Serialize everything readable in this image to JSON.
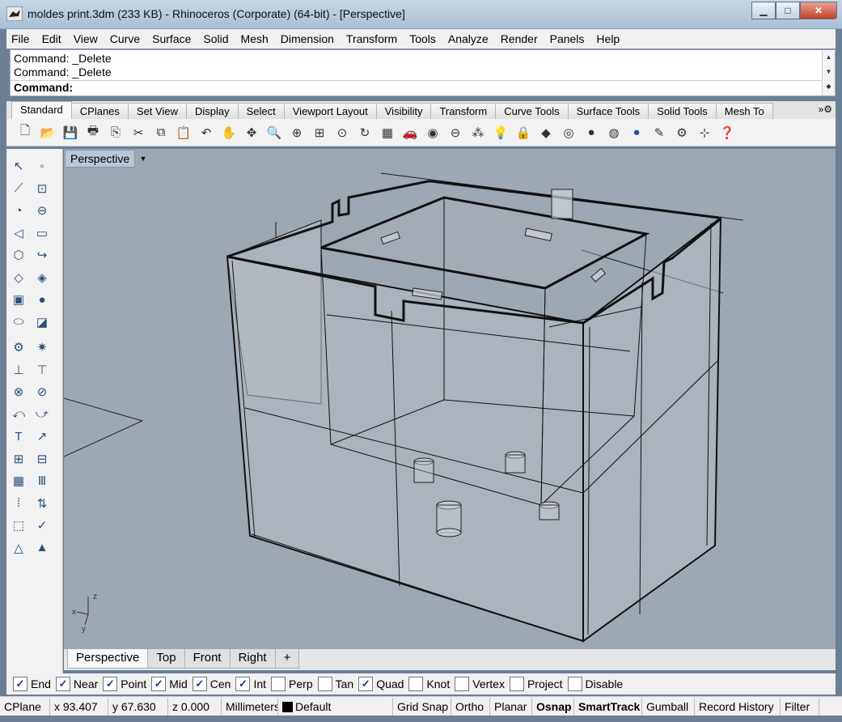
{
  "window": {
    "title": "moldes print.3dm (233 KB) - Rhinoceros (Corporate) (64-bit) - [Perspective]",
    "minimize": "▁",
    "maximize": "□",
    "close": "✕"
  },
  "menu": [
    "File",
    "Edit",
    "View",
    "Curve",
    "Surface",
    "Solid",
    "Mesh",
    "Dimension",
    "Transform",
    "Tools",
    "Analyze",
    "Render",
    "Panels",
    "Help"
  ],
  "command": {
    "history": [
      "Command: _Delete",
      "Command: _Delete"
    ],
    "prompt": "Command:"
  },
  "toolbar_tabs": [
    "Standard",
    "CPlanes",
    "Set View",
    "Display",
    "Select",
    "Viewport Layout",
    "Visibility",
    "Transform",
    "Curve Tools",
    "Surface Tools",
    "Solid Tools",
    "Mesh To"
  ],
  "active_toolbar_tab": "Standard",
  "toolbar_icons": [
    "new-icon",
    "open-icon",
    "save-icon",
    "print-icon",
    "import-icon",
    "cut-icon",
    "copy-icon",
    "paste-icon",
    "undo-icon",
    "pan-icon",
    "rotate-view-icon",
    "zoom-icon",
    "zoom-window-icon",
    "zoom-extents-icon",
    "zoom-selected-icon",
    "redraw-icon",
    "viewport-layout-icon",
    "car-icon",
    "camera-icon",
    "point-icon",
    "lock-icon",
    "light-icon",
    "layer-lock-icon",
    "render-icon",
    "color-wheel-icon",
    "material-sphere-icon",
    "display-sphere-icon",
    "render-sphere-icon",
    "pencil-icon",
    "settings-icon",
    "grid-icon",
    "help-icon"
  ],
  "left_tools": [
    "select-icon",
    "point-icon",
    "polyline-icon",
    "curve-icon",
    "circle-icon",
    "ellipse-icon",
    "arc-icon",
    "rectangle-icon",
    "polygon-icon",
    "fillet-icon",
    "surface-icon",
    "loft-icon",
    "box-icon",
    "sphere-icon",
    "cylinder-icon",
    "extrude-icon",
    "gear-icon",
    "explode-icon",
    "trim-icon",
    "split-icon",
    "boolean-icon",
    "boolean-split-icon",
    "offset-icon",
    "blend-icon",
    "text-icon",
    "dimension-icon",
    "array-icon",
    "transform-icon",
    "solid-box-icon",
    "bar-icon",
    "polygon-array-icon",
    "snap-icon",
    "cube-icon",
    "check-icon",
    "shapes-icon",
    "pyramid-icon"
  ],
  "viewport": {
    "label": "Perspective",
    "axis_x": "x",
    "axis_y": "y",
    "axis_z": "z"
  },
  "viewport_tabs": [
    "Perspective",
    "Top",
    "Front",
    "Right",
    "+"
  ],
  "active_viewport_tab": "Perspective",
  "osnaps": [
    {
      "label": "End",
      "checked": true
    },
    {
      "label": "Near",
      "checked": true
    },
    {
      "label": "Point",
      "checked": true
    },
    {
      "label": "Mid",
      "checked": true
    },
    {
      "label": "Cen",
      "checked": true
    },
    {
      "label": "Int",
      "checked": true
    },
    {
      "label": "Perp",
      "checked": false
    },
    {
      "label": "Tan",
      "checked": false
    },
    {
      "label": "Quad",
      "checked": true
    },
    {
      "label": "Knot",
      "checked": false
    },
    {
      "label": "Vertex",
      "checked": false
    },
    {
      "label": "Project",
      "checked": false
    },
    {
      "label": "Disable",
      "checked": false
    }
  ],
  "status": {
    "cplane": "CPlane",
    "x": "x 93.407",
    "y": "y 67.630",
    "z": "z 0.000",
    "units": "Millimeters",
    "layer": "Default",
    "grid_snap": "Grid Snap",
    "ortho": "Ortho",
    "planar": "Planar",
    "osnap": "Osnap",
    "smarttrack": "SmartTrack",
    "gumball": "Gumball",
    "record_history": "Record History",
    "filter": "Filter"
  },
  "colors": {
    "viewport_bg": "#9ea8b3",
    "titlebar": "#b9cbe0",
    "close_button": "#c94a35"
  }
}
